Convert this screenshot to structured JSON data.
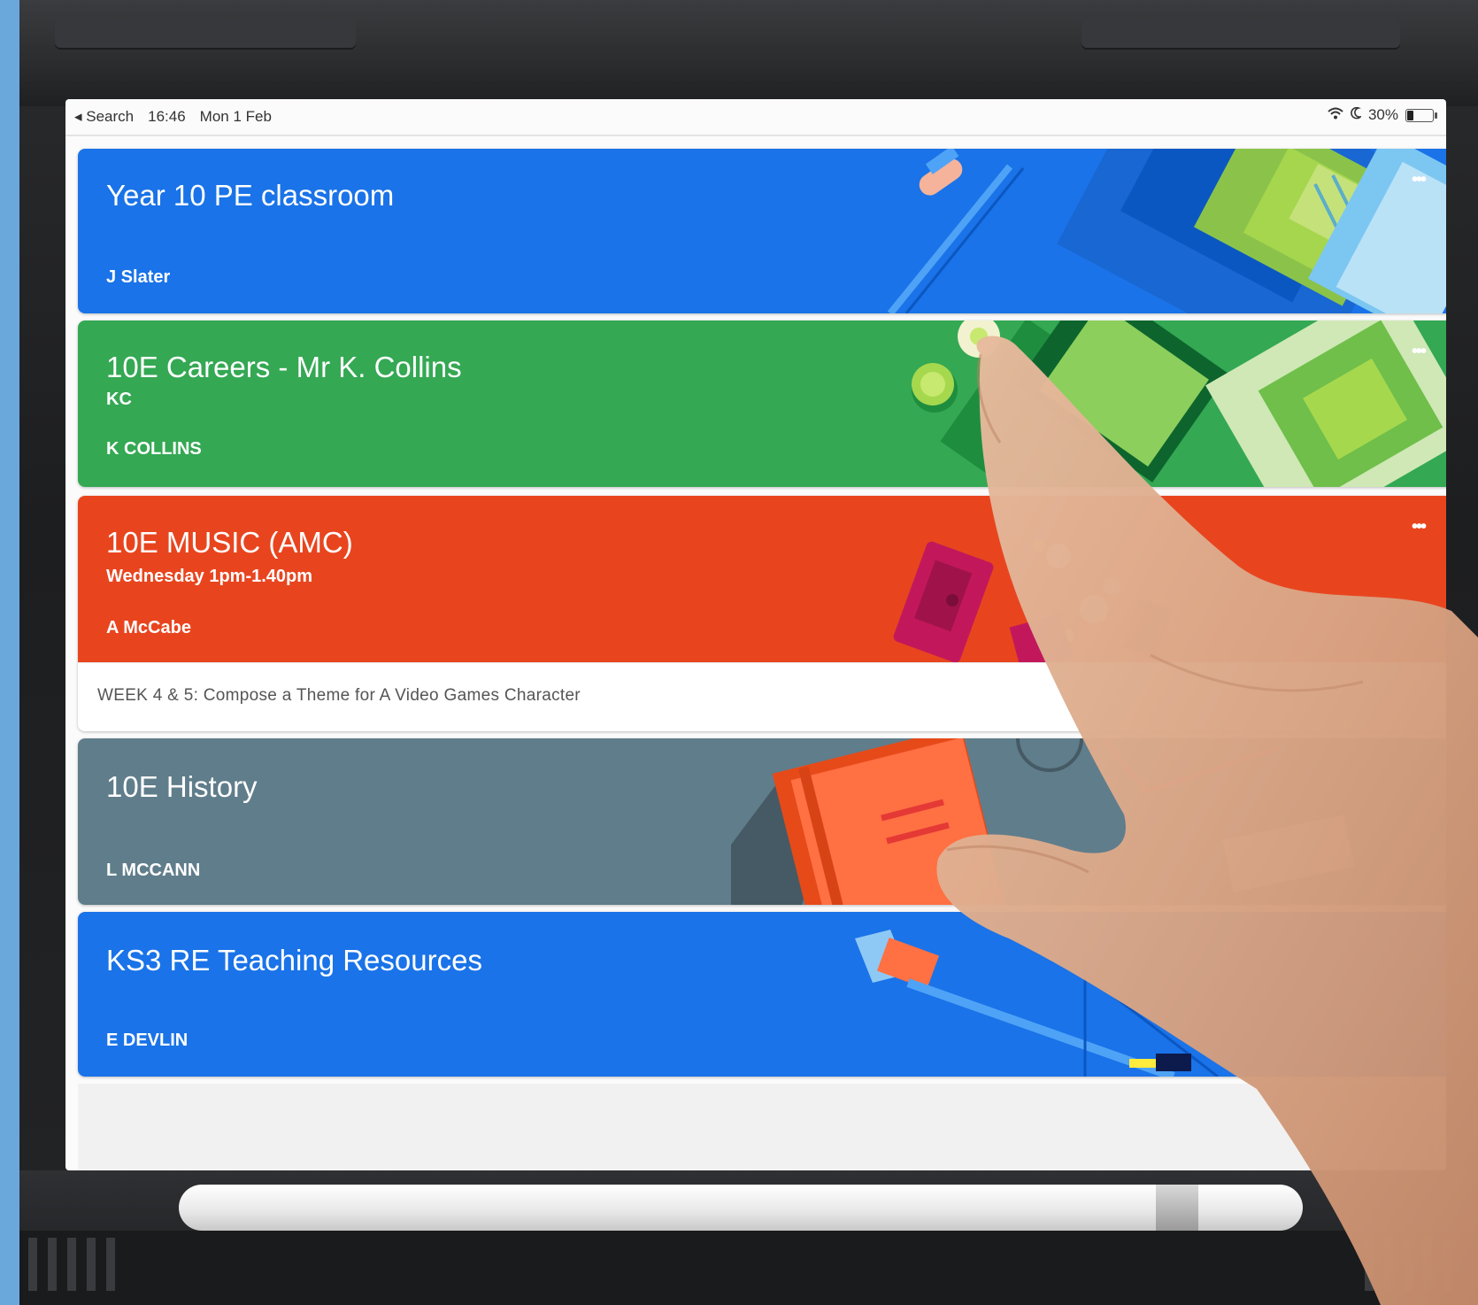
{
  "status_bar": {
    "back_label": "◂ Search",
    "time": "16:46",
    "date": "Mon 1 Feb",
    "battery": "30%"
  },
  "classes": [
    {
      "title": "Year 10 PE classroom",
      "subtitle": "",
      "teacher": "J Slater",
      "color": "#1a73e8",
      "more_label": "•••"
    },
    {
      "title": "10E Careers - Mr K. Collins",
      "subtitle": "KC",
      "teacher": "K COLLINS",
      "color": "#1e8e3e",
      "more_label": "•••"
    },
    {
      "title": "10E MUSIC (AMC)",
      "subtitle": "Wednesday 1pm-1.40pm",
      "teacher": "A McCabe",
      "color": "#e8451f",
      "more_label": "•••",
      "footer": "WEEK 4 & 5:  Compose a Theme for A Video Games Character"
    },
    {
      "title": "10E History",
      "subtitle": "",
      "teacher": "L MCCANN",
      "color": "#607d8b",
      "more_label": ""
    },
    {
      "title": "KS3 RE Teaching Resources",
      "subtitle": "",
      "teacher": "E DEVLIN",
      "color": "#1a73e8",
      "more_label": ""
    }
  ]
}
